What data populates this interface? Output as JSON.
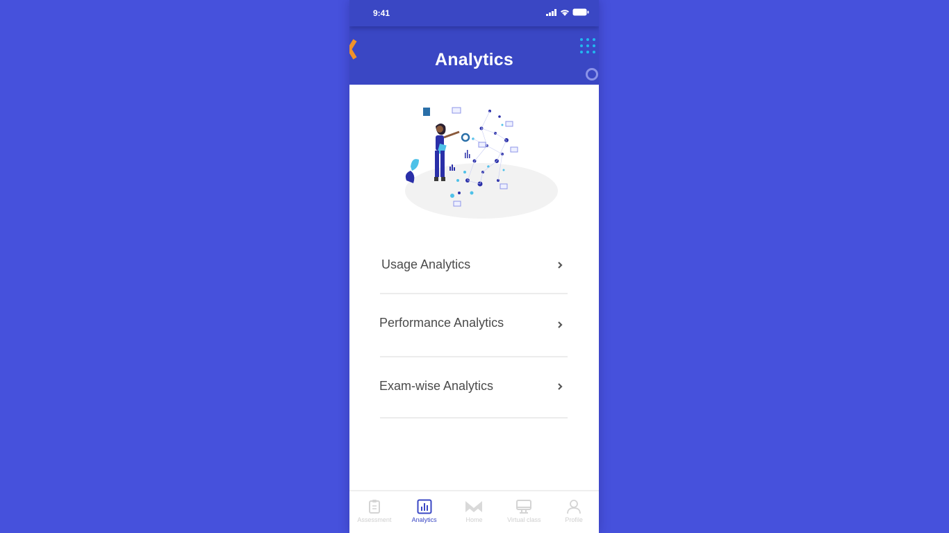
{
  "status_bar": {
    "time": "9:41"
  },
  "header": {
    "title": "Analytics"
  },
  "menu": {
    "items": [
      {
        "label": "Usage Analytics"
      },
      {
        "label": "Performance Analytics"
      },
      {
        "label": "Exam-wise Analytics"
      }
    ]
  },
  "tab_bar": {
    "tabs": [
      {
        "label": "Assessment",
        "icon": "clipboard-icon",
        "active": false
      },
      {
        "label": "Analytics",
        "icon": "bar-chart-icon",
        "active": true
      },
      {
        "label": "Home",
        "icon": "home-logo-icon",
        "active": false
      },
      {
        "label": "Virtual class",
        "icon": "monitor-icon",
        "active": false
      },
      {
        "label": "Profile",
        "icon": "user-icon",
        "active": false
      }
    ]
  },
  "colors": {
    "background": "#4651dc",
    "header": "#3a47c4",
    "accent_back": "#f0922a",
    "dots": "#22b8f0",
    "active_tab": "#3a47c4",
    "inactive_tab": "#cfcfcf"
  }
}
